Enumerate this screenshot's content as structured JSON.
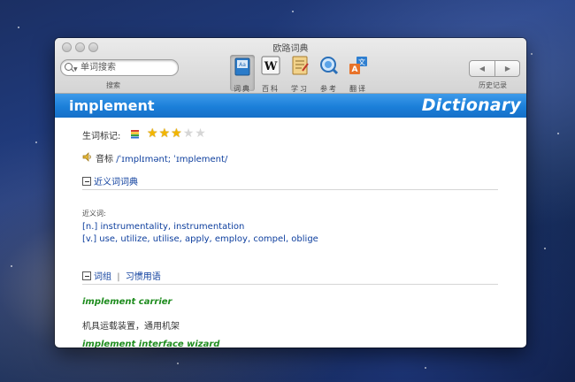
{
  "app": {
    "title": "欧路词典"
  },
  "toolbar": {
    "search_placeholder": "单词搜索",
    "search_label": "搜索",
    "tools": [
      {
        "label": "词典",
        "icon": "dictionary-icon",
        "active": true
      },
      {
        "label": "百科",
        "icon": "wikipedia-icon",
        "active": false
      },
      {
        "label": "学习",
        "icon": "study-icon",
        "active": false
      },
      {
        "label": "参考",
        "icon": "reference-icon",
        "active": false
      },
      {
        "label": "翻译",
        "icon": "translate-icon",
        "active": false
      }
    ],
    "history_back": "◀",
    "history_forward": "▶",
    "history_label": "历史记录"
  },
  "entry": {
    "headword": "implement",
    "dictionary_label": "Dictionary",
    "word_tag_label": "生词标记:",
    "rating": 3,
    "rating_max": 5,
    "pron_label": "音标",
    "phonetic": "/ˈɪmplɪmənt; ˈɪmplement/",
    "sections": {
      "synonyms_title": "近义词词典",
      "synonyms_label": "近义词:",
      "noun_line": "[n.] instrumentality, instrumentation",
      "verb_line": "[v.] use, utilize, utilise, apply, employ, compel, oblige",
      "phrases_title_a": "词组",
      "phrases_sep": "|",
      "phrases_title_b": "习惯用语",
      "phrase1": "implement carrier",
      "phrase1_def": "机具运载装置，通用机架",
      "phrase2": "implement interface wizard"
    }
  },
  "colors": {
    "banner_blue": "#1b7fd9",
    "link_blue": "#0e3f9e",
    "phrase_green": "#1e8c1e",
    "star_gold": "#f2b600"
  }
}
